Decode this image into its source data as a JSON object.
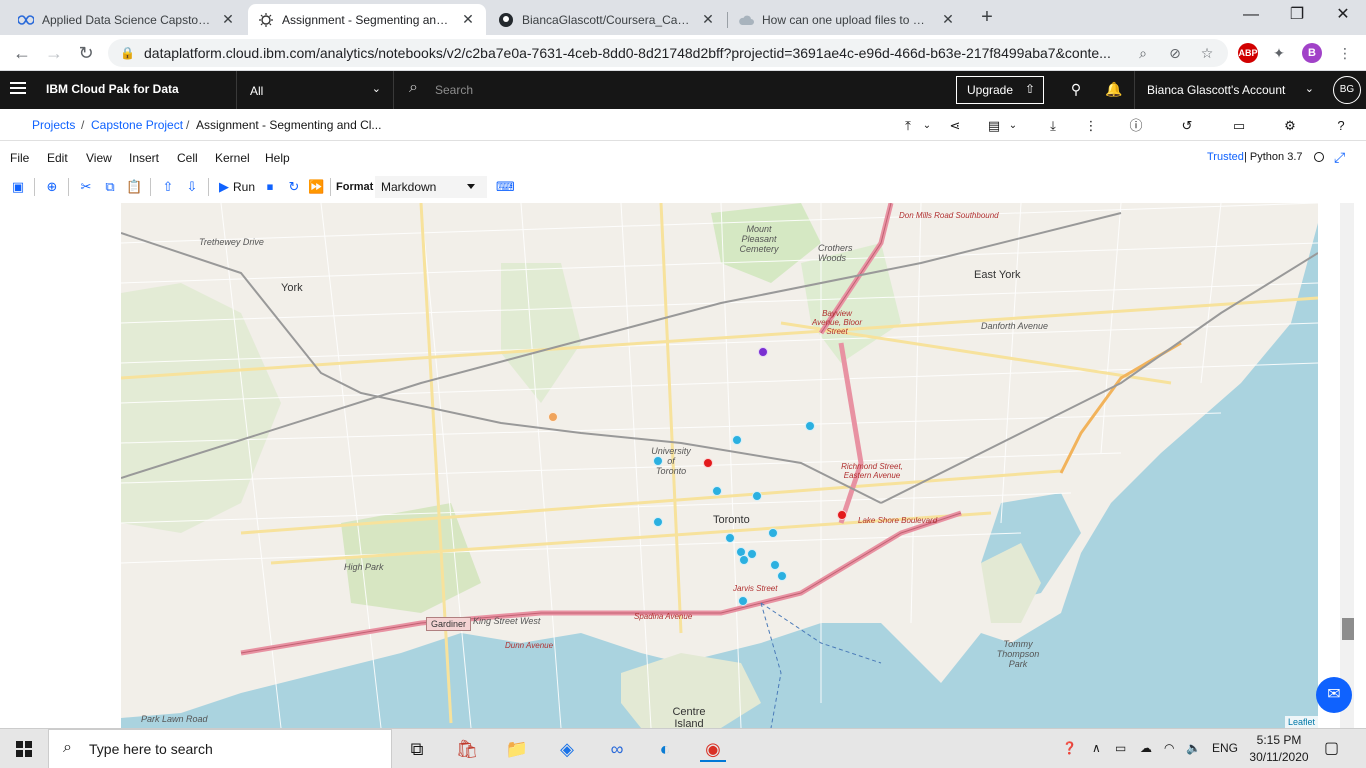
{
  "browser": {
    "tabs": [
      {
        "title": "Applied Data Science Capstone -",
        "icon": "infinity-icon"
      },
      {
        "title": "Assignment - Segmenting and Cl",
        "icon": "jupyter-icon",
        "active": true
      },
      {
        "title": "BiancaGlascott/Coursera_Capsto",
        "icon": "github-icon"
      },
      {
        "title": "How can one upload files to GitH",
        "icon": "cloud-icon"
      }
    ],
    "url": "dataplatform.cloud.ibm.com/analytics/notebooks/v2/c2ba7e0a-7631-4ceb-8dd0-8d21748d2bff?projectid=3691ae4c-e96d-466d-b63e-217f8499aba7&conte...",
    "profile_initial": "B",
    "abp_label": "ABP"
  },
  "ibm": {
    "title": "IBM Cloud Pak for Data",
    "scope": "All",
    "search_placeholder": "Search",
    "upgrade": "Upgrade",
    "account": "Bianca Glascott's Account",
    "avatar": "BG"
  },
  "breadcrumb": {
    "projects": "Projects",
    "project": "Capstone Project",
    "current": "Assignment - Segmenting and Cl...",
    "sep": "/"
  },
  "notebook": {
    "menu": [
      "File",
      "Edit",
      "View",
      "Insert",
      "Cell",
      "Kernel",
      "Help"
    ],
    "trusted": "Trusted",
    "kernel": "| Python 3.7",
    "run_label": "Run",
    "format_label": "Format",
    "format_value": "Markdown"
  },
  "map": {
    "labels": [
      {
        "text": "Don Mills Road Southbound",
        "cls": "red"
      },
      {
        "text": "Mount Pleasant Cemetery",
        "cls": ""
      },
      {
        "text": "Crothers Woods",
        "cls": ""
      },
      {
        "text": "East York",
        "cls": "big"
      },
      {
        "text": "York",
        "cls": "big"
      },
      {
        "text": "Trethewey Drive",
        "cls": ""
      },
      {
        "text": "Bayview Avenue, Bloor Street",
        "cls": "red"
      },
      {
        "text": "Danforth Avenue",
        "cls": ""
      },
      {
        "text": "University of Toronto",
        "cls": ""
      },
      {
        "text": "Toronto",
        "cls": "big"
      },
      {
        "text": "Richmond Street, Eastern Avenue",
        "cls": "red"
      },
      {
        "text": "Lake Shore Boulevard",
        "cls": "red"
      },
      {
        "text": "High Park",
        "cls": ""
      },
      {
        "text": "King Street West",
        "cls": ""
      },
      {
        "text": "Spadina Avenue",
        "cls": "red"
      },
      {
        "text": "Jarvis Street",
        "cls": "red"
      },
      {
        "text": "Dunn Avenue",
        "cls": "red"
      },
      {
        "text": "Tommy Thompson Park",
        "cls": ""
      },
      {
        "text": "Centre Island",
        "cls": "big"
      },
      {
        "text": "Park Lawn Road",
        "cls": ""
      }
    ],
    "gardiner": "Gardiner",
    "attribution": "Leaflet",
    "markers": [
      {
        "color": "#7a2fd1"
      },
      {
        "color": "#f0a45c"
      },
      {
        "color": "#e31a1c"
      },
      {
        "color": "#e31a1c"
      },
      {
        "color": "#2bb0e0"
      },
      {
        "color": "#2bb0e0"
      },
      {
        "color": "#2bb0e0"
      },
      {
        "color": "#2bb0e0"
      },
      {
        "color": "#2bb0e0"
      },
      {
        "color": "#2bb0e0"
      },
      {
        "color": "#2bb0e0"
      },
      {
        "color": "#2bb0e0"
      },
      {
        "color": "#2bb0e0"
      },
      {
        "color": "#2bb0e0"
      },
      {
        "color": "#2bb0e0"
      },
      {
        "color": "#2bb0e0"
      },
      {
        "color": "#2bb0e0"
      }
    ]
  },
  "taskbar": {
    "search_placeholder": "Type here to search",
    "lang": "ENG",
    "time": "5:15 PM",
    "date": "30/11/2020"
  }
}
